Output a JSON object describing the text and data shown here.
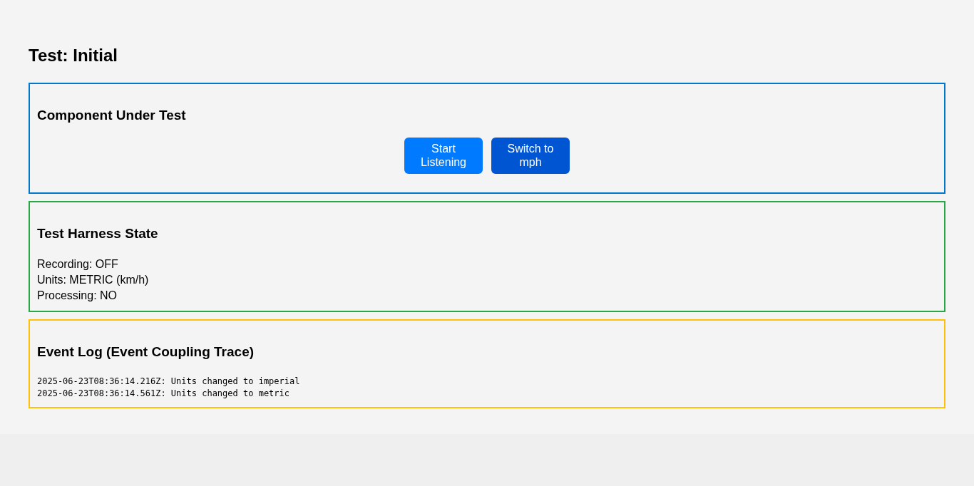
{
  "title": "Test: Initial",
  "component_panel": {
    "heading": "Component Under Test",
    "color": "#0077cc",
    "buttons": [
      {
        "label": "Start Listening",
        "kind": "primary"
      },
      {
        "label": "Switch to mph",
        "kind": "secondary"
      }
    ]
  },
  "state_panel": {
    "heading": "Test Harness State",
    "color": "#28a745",
    "lines": [
      "Recording: OFF",
      "Units: METRIC (km/h)",
      "Processing: NO"
    ]
  },
  "log_panel": {
    "heading": "Event Log (Event Coupling Trace)",
    "color": "#ffc107",
    "entries": [
      "2025-06-23T08:36:14.216Z: Units changed to imperial",
      "2025-06-23T08:36:14.561Z: Units changed to metric"
    ]
  }
}
